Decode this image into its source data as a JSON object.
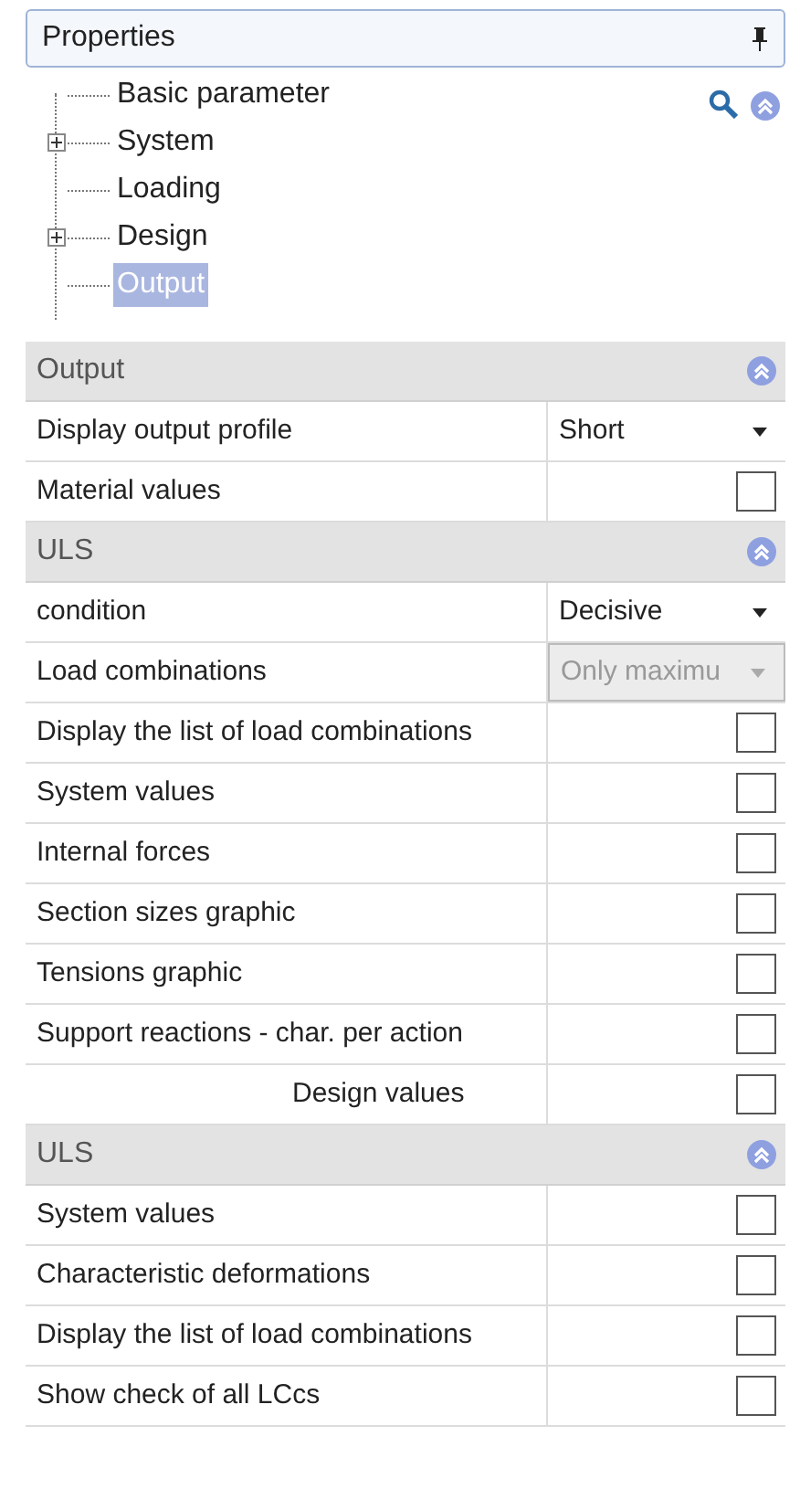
{
  "panel": {
    "title": "Properties"
  },
  "tree": [
    {
      "label": "Basic parameter",
      "expandable": false,
      "selected": false
    },
    {
      "label": "System",
      "expandable": true,
      "selected": false
    },
    {
      "label": "Loading",
      "expandable": false,
      "selected": false
    },
    {
      "label": "Design",
      "expandable": true,
      "selected": false
    },
    {
      "label": "Output",
      "expandable": false,
      "selected": true
    }
  ],
  "sections": [
    {
      "title": "Output",
      "rows": [
        {
          "kind": "dropdown",
          "label": "Display output profile",
          "value": "Short",
          "disabled": false
        },
        {
          "kind": "checkbox",
          "label": "Material values",
          "checked": false
        }
      ]
    },
    {
      "title": "ULS",
      "rows": [
        {
          "kind": "dropdown",
          "label": "condition",
          "value": "Decisive",
          "disabled": false
        },
        {
          "kind": "dropdown",
          "label": "Load combinations",
          "value": "Only maximu",
          "disabled": true
        },
        {
          "kind": "checkbox",
          "label": "Display the list of load combinations",
          "checked": false
        },
        {
          "kind": "checkbox",
          "label": "System values",
          "checked": false
        },
        {
          "kind": "checkbox",
          "label": "Internal forces",
          "checked": false
        },
        {
          "kind": "checkbox",
          "label": "Section sizes graphic",
          "checked": false
        },
        {
          "kind": "checkbox",
          "label": "Tensions graphic",
          "checked": false
        },
        {
          "kind": "checkbox",
          "label": "Support reactions - char. per action",
          "checked": false
        },
        {
          "kind": "subcheckbox",
          "label": "Design values",
          "checked": false
        }
      ]
    },
    {
      "title": "ULS",
      "rows": [
        {
          "kind": "checkbox",
          "label": "System values",
          "checked": false
        },
        {
          "kind": "checkbox",
          "label": "Characteristic deformations",
          "checked": false
        },
        {
          "kind": "checkbox",
          "label": "Display the list of load combinations",
          "checked": false
        },
        {
          "kind": "checkbox",
          "label": "Show check of all LCcs",
          "checked": false
        }
      ]
    }
  ]
}
